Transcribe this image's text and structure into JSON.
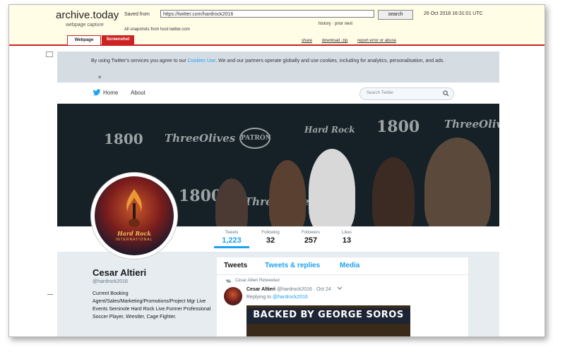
{
  "archive": {
    "brand": "archive.today",
    "brand_sub": "webpage capture",
    "saved_from_label": "Saved from",
    "url": "https://twitter.com/hardrock2016",
    "search_label": "search",
    "date": "26 Oct 2018 16:31:01 UTC",
    "history_links": "history · prior next",
    "all_snapshots": "All snapshots from host twitter.com",
    "tab_webpage": "Webpage",
    "tab_screenshot": "Screenshot",
    "actions": [
      "share",
      "download .zip",
      "report error or abuse"
    ]
  },
  "twitter": {
    "cookie_text_before": "By using Twitter's services you agree to our ",
    "cookie_link": "Cookies Use",
    "cookie_text_after": ". We and our partners operate globally and use cookies, including for analytics, personalisation, and ads.",
    "cookie_close": "×",
    "nav_home": "Home",
    "nav_about": "About",
    "search_placeholder": "Search Twitter",
    "header_logos": [
      "1800",
      "ThreeOlives",
      "PATRÓN",
      "Hard Rock",
      "1800",
      "ThreeOlives",
      "1800",
      "ThreeOlives"
    ],
    "avatar_text": "Hard Rock",
    "avatar_sub": "INTERNATIONAL",
    "stats": [
      {
        "label": "Tweets",
        "value": "1,223"
      },
      {
        "label": "Following",
        "value": "32"
      },
      {
        "label": "Followers",
        "value": "257"
      },
      {
        "label": "Likes",
        "value": "13"
      }
    ],
    "profile": {
      "name": "Cesar Altieri",
      "handle": "@hardrock2016",
      "bio": "Current Booking Agent/Sales/Marketing/Promotions/Project Mgr Live Events Seminole Hard Rock Live.Former Professional Soccer Player, Wrestler, Cage Fighter."
    },
    "tabs": [
      "Tweets",
      "Tweets & replies",
      "Media"
    ],
    "tweet": {
      "retweet_label": "Cesar Altieri Retweeted",
      "name": "Cesar Altieri",
      "handle": "@hardrock2016",
      "sep": "·",
      "date": "Oct 24",
      "replying_to": "Replying to ",
      "replying_handle": "@hardrock2016",
      "image_text": "BACKED BY GEORGE SOROS"
    }
  },
  "colors": {
    "twitter_blue": "#1da1f2",
    "archive_red": "#cc2222"
  }
}
